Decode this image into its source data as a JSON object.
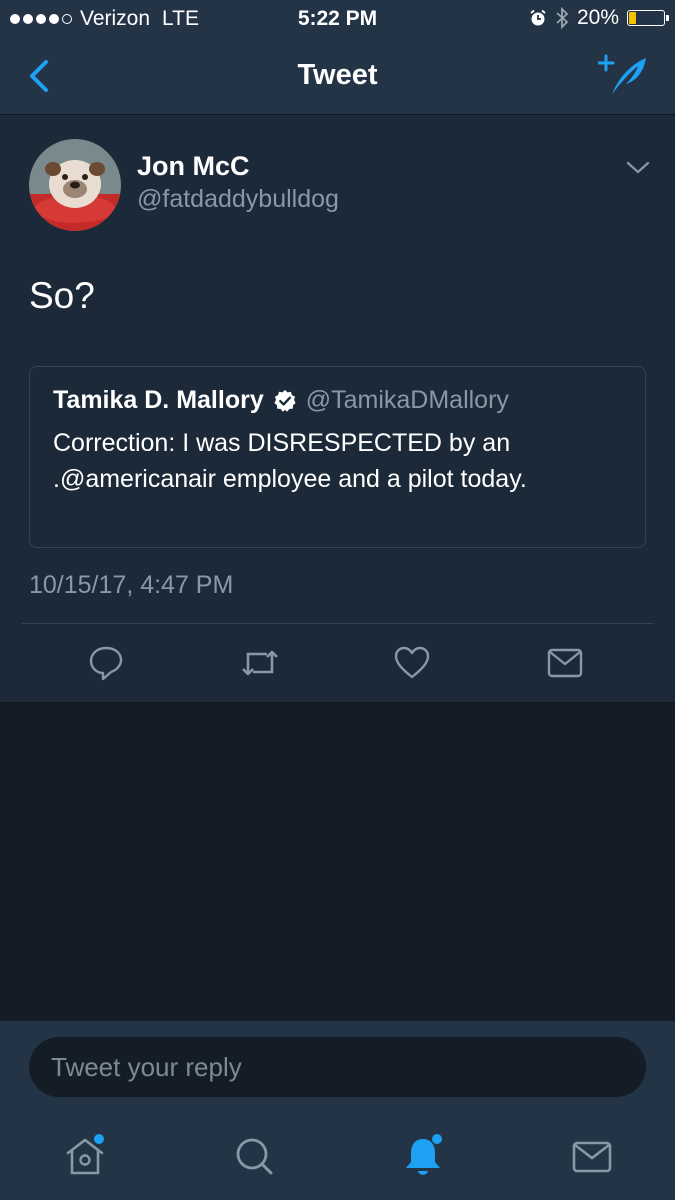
{
  "status_bar": {
    "carrier": "Verizon",
    "network": "LTE",
    "time": "5:22 PM",
    "battery_percent": "20%",
    "signal_bars": 4,
    "battery_level": 0.2,
    "icons": [
      "alarm-icon",
      "bluetooth-icon",
      "battery-icon"
    ]
  },
  "nav": {
    "title": "Tweet",
    "back_icon": "chevron-left-icon",
    "compose_icon": "compose-feather-icon"
  },
  "tweet": {
    "author_name": "Jon McC",
    "author_handle": "@fatdaddybulldog",
    "text": "So?",
    "timestamp": "10/15/17, 4:47 PM",
    "quoted": {
      "name": "Tamika D. Mallory",
      "verified": true,
      "handle": "@TamikaDMallory",
      "text": "Correction: I was DISRESPECTED by an .@americanair employee and a pilot today."
    },
    "actions": [
      "reply-icon",
      "retweet-icon",
      "like-icon",
      "direct-message-icon"
    ]
  },
  "reply": {
    "placeholder": "Tweet your reply"
  },
  "tabs": [
    {
      "name": "home",
      "icon": "home-icon",
      "badge": true
    },
    {
      "name": "search",
      "icon": "search-icon",
      "badge": false
    },
    {
      "name": "notifications",
      "icon": "bell-icon",
      "badge": true,
      "active": true
    },
    {
      "name": "messages",
      "icon": "mail-icon",
      "badge": false
    }
  ],
  "colors": {
    "background": "#141d26",
    "card": "#1c2938",
    "bar": "#243447",
    "accent": "#1da1f2",
    "secondary_text": "#8899a6",
    "border": "#38444d",
    "battery": "#f5c400"
  }
}
